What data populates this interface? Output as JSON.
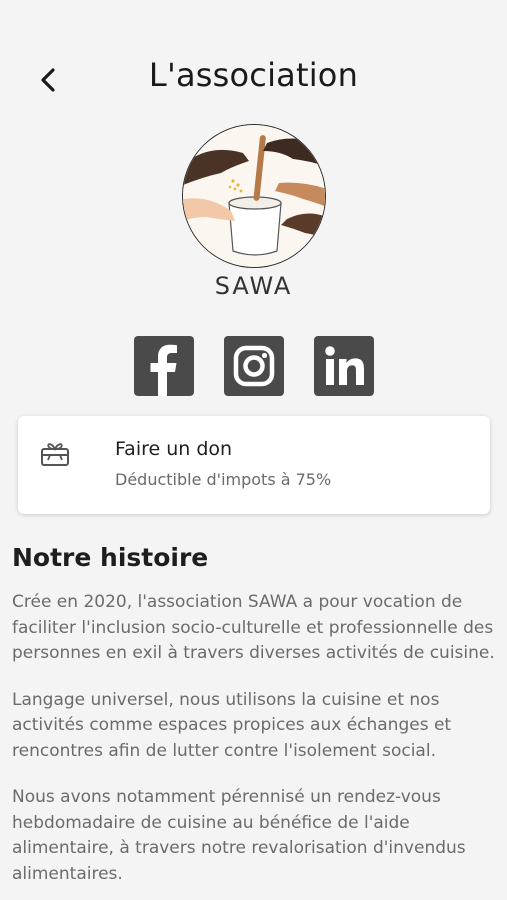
{
  "status_bar": {
    "left": "",
    "center": "",
    "right": ""
  },
  "header": {
    "title": "L'association"
  },
  "logo": {
    "name": "SAWA"
  },
  "socials": [
    {
      "name": "facebook",
      "icon": "facebook-icon"
    },
    {
      "name": "instagram",
      "icon": "instagram-icon"
    },
    {
      "name": "linkedin",
      "icon": "linkedin-icon"
    }
  ],
  "donate": {
    "title": "Faire un don",
    "subtitle": "Déductible d'impots à 75%",
    "icon": "gift-card-icon"
  },
  "story": {
    "title": "Notre histoire",
    "paragraphs": [
      "Crée en 2020, l'association SAWA a pour vocation de faciliter l'inclusion socio-culturelle et professionnelle des personnes en exil à travers diverses activités de cuisine.",
      "Langage universel, nous utilisons la cuisine et nos activités comme espaces propices aux échanges et rencontres afin de lutter contre l'isolement social.",
      "Nous avons notamment pérennisé un rendez-vous hebdomadaire de cuisine au bénéfice de l'aide alimentaire, à travers notre revalorisation d'invendus alimentaires."
    ]
  },
  "colors": {
    "background": "#f4f4f4",
    "icon_tile": "#4a4a4a",
    "card": "#ffffff",
    "muted_text": "#6b6b6b"
  }
}
